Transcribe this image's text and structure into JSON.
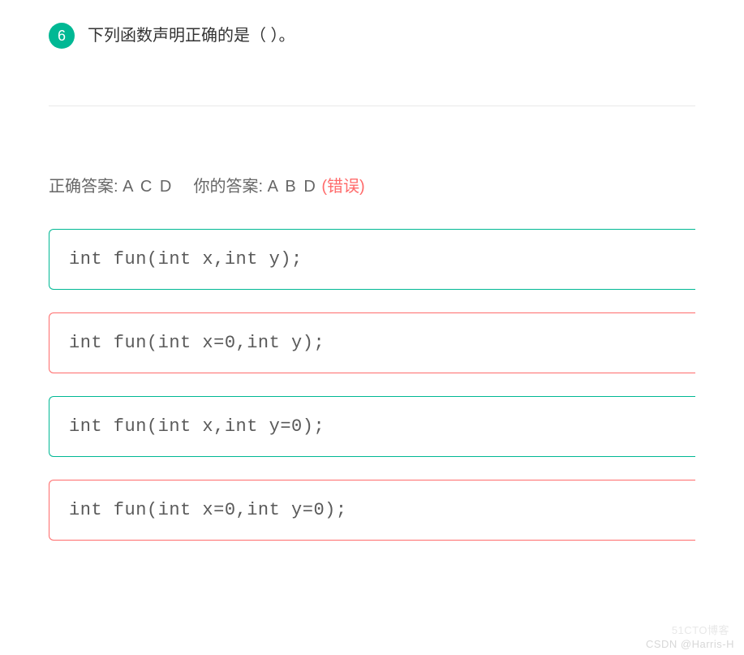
{
  "question": {
    "number": "6",
    "text": "下列函数声明正确的是（     ）。"
  },
  "answers": {
    "correct_label": "正确答案:",
    "correct_value": "A C D",
    "your_label": "你的答案:",
    "your_value": "A B D",
    "wrong_marker": "(错误)"
  },
  "options": [
    {
      "code": "int fun(int x,int y);",
      "status": "correct"
    },
    {
      "code": "int fun(int x=0,int y);",
      "status": "wrong"
    },
    {
      "code": "int fun(int x,int y=0);",
      "status": "correct"
    },
    {
      "code": "int fun(int x=0,int y=0);",
      "status": "wrong"
    }
  ],
  "watermark1": "CSDN @Harris-H",
  "watermark2": "51CTO博客"
}
